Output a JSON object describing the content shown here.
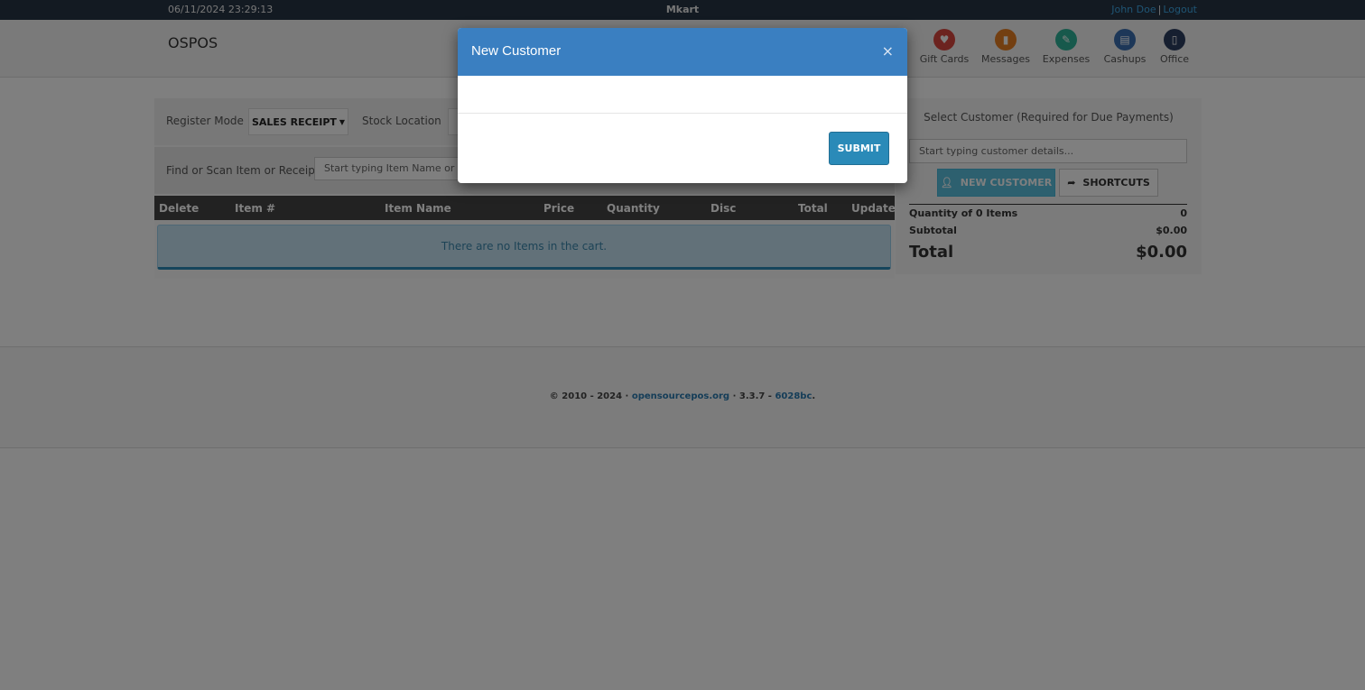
{
  "topbar": {
    "datetime": "06/11/2024 23:29:13",
    "brand": "Mkart",
    "user_name": "John Doe",
    "separator": "|",
    "logout": "Logout"
  },
  "header": {
    "logo": "OSPOS",
    "modules": [
      {
        "label": "Gift Cards",
        "icon": "gift-card-icon"
      },
      {
        "label": "Messages",
        "icon": "messages-icon"
      },
      {
        "label": "Expenses",
        "icon": "expenses-icon"
      },
      {
        "label": "Cashups",
        "icon": "cashups-icon"
      },
      {
        "label": "Office",
        "icon": "office-icon"
      }
    ]
  },
  "register": {
    "mode_label": "Register Mode",
    "mode_value": "SALES RECEIPT",
    "location_label": "Stock Location",
    "find_label": "Find or Scan Item or Receipt",
    "find_placeholder": "Start typing Item Name or scan Barcode...",
    "columns": [
      "Delete",
      "Item #",
      "Item Name",
      "Price",
      "Quantity",
      "Disc",
      "Total",
      "Update"
    ],
    "empty_message": "There are no Items in the cart."
  },
  "customer": {
    "title": "Select Customer (Required for Due Payments)",
    "input_placeholder": "Start typing customer details...",
    "new_customer_label": "NEW CUSTOMER",
    "shortcuts_label": "SHORTCUTS",
    "quantity_label": "Quantity of 0 Items",
    "quantity_value": "0",
    "subtotal_label": "Subtotal",
    "subtotal_value": "$0.00",
    "total_label": "Total",
    "total_value": "$0.00"
  },
  "footer": {
    "copyright": "© 2010 - 2024 · ",
    "site_link": "opensourcepos.org",
    "version": " · 3.3.7 - ",
    "commit": "6028bc",
    "end": "."
  },
  "modal": {
    "title": "New Customer",
    "close": "×",
    "submit_label": "SUBMIT"
  }
}
